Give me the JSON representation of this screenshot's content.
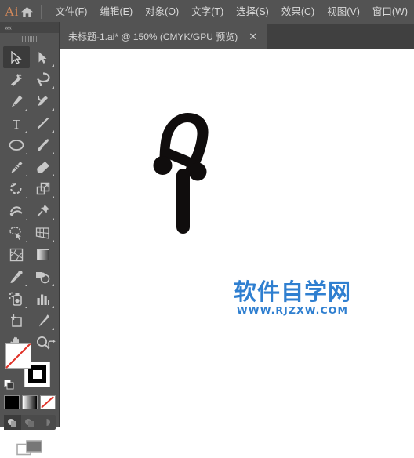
{
  "app": {
    "logo_text": "Ai",
    "logo_color": "#d2885a",
    "home_icon": "home-icon"
  },
  "menubar": {
    "items": [
      {
        "label": "文件(F)",
        "name": "menu-file"
      },
      {
        "label": "编辑(E)",
        "name": "menu-edit"
      },
      {
        "label": "对象(O)",
        "name": "menu-object"
      },
      {
        "label": "文字(T)",
        "name": "menu-type"
      },
      {
        "label": "选择(S)",
        "name": "menu-select"
      },
      {
        "label": "效果(C)",
        "name": "menu-effect"
      },
      {
        "label": "视图(V)",
        "name": "menu-view"
      },
      {
        "label": "窗口(W)",
        "name": "menu-window"
      }
    ]
  },
  "tabbar": {
    "active_tab": {
      "title": "未标题-1.ai* @ 150% (CMYK/GPU 预览)",
      "close_label": "✕",
      "document_name": "未标题-1.ai",
      "modified": true,
      "zoom": "150%",
      "color_mode": "CMYK",
      "preview_mode": "GPU 预览"
    }
  },
  "toolpanel": {
    "collapse_label": "««",
    "active_tool": "selection-tool",
    "tools": [
      {
        "name": "selection-tool",
        "icon": "arrow-cursor-icon",
        "has_flyout": false
      },
      {
        "name": "direct-selection-tool",
        "icon": "white-arrow-cursor-icon",
        "has_flyout": true
      },
      {
        "name": "magic-wand-tool",
        "icon": "magic-wand-icon",
        "has_flyout": false
      },
      {
        "name": "lasso-tool",
        "icon": "lasso-icon",
        "has_flyout": true
      },
      {
        "name": "pen-tool",
        "icon": "pen-nib-icon",
        "has_flyout": true
      },
      {
        "name": "curvature-tool",
        "icon": "curvature-pen-icon",
        "has_flyout": true
      },
      {
        "name": "type-tool",
        "icon": "type-T-icon",
        "has_flyout": true
      },
      {
        "name": "line-segment-tool",
        "icon": "diagonal-line-icon",
        "has_flyout": true
      },
      {
        "name": "ellipse-tool",
        "icon": "ellipse-icon",
        "has_flyout": true
      },
      {
        "name": "paintbrush-tool",
        "icon": "paintbrush-icon",
        "has_flyout": true
      },
      {
        "name": "shaper-tool",
        "icon": "pencil-shaper-icon",
        "has_flyout": true
      },
      {
        "name": "eraser-tool",
        "icon": "eraser-icon",
        "has_flyout": true
      },
      {
        "name": "rotate-tool",
        "icon": "rotate-icon",
        "has_flyout": true
      },
      {
        "name": "scale-tool",
        "icon": "scale-boxes-icon",
        "has_flyout": true
      },
      {
        "name": "width-tool",
        "icon": "width-warp-icon",
        "has_flyout": true
      },
      {
        "name": "free-transform-tool",
        "icon": "pushpin-icon",
        "has_flyout": true
      },
      {
        "name": "shape-builder-tool",
        "icon": "shape-builder-icon",
        "has_flyout": true
      },
      {
        "name": "perspective-grid-tool",
        "icon": "perspective-grid-icon",
        "has_flyout": true
      },
      {
        "name": "mesh-tool",
        "icon": "mesh-icon",
        "has_flyout": false
      },
      {
        "name": "gradient-tool",
        "icon": "gradient-icon",
        "has_flyout": false
      },
      {
        "name": "eyedropper-tool",
        "icon": "eyedropper-icon",
        "has_flyout": true
      },
      {
        "name": "blend-tool",
        "icon": "blend-icon",
        "has_flyout": true
      },
      {
        "name": "symbol-sprayer-tool",
        "icon": "symbol-sprayer-icon",
        "has_flyout": true
      },
      {
        "name": "column-graph-tool",
        "icon": "bar-chart-icon",
        "has_flyout": true
      },
      {
        "name": "artboard-tool",
        "icon": "artboard-icon",
        "has_flyout": false
      },
      {
        "name": "slice-tool",
        "icon": "slice-knife-icon",
        "has_flyout": true
      },
      {
        "name": "hand-tool",
        "icon": "hand-icon",
        "has_flyout": true
      },
      {
        "name": "zoom-tool",
        "icon": "magnifier-icon",
        "has_flyout": false
      }
    ],
    "swatches": {
      "fill": {
        "name": "fill-swatch",
        "value": "none",
        "color": "#ffffff"
      },
      "stroke": {
        "name": "stroke-swatch",
        "value": "black",
        "color": "#000000"
      },
      "swap_icon": "swap-arrow-icon",
      "default_icon": "default-fill-stroke-icon",
      "modes": [
        {
          "name": "color-mode-button",
          "label": "solid-color",
          "selected": false
        },
        {
          "name": "gradient-mode-button",
          "label": "gradient",
          "selected": false
        },
        {
          "name": "none-mode-button",
          "label": "none",
          "selected": true
        }
      ],
      "draw_modes": [
        {
          "name": "draw-normal-button",
          "selected": true
        },
        {
          "name": "draw-behind-button",
          "selected": false
        },
        {
          "name": "draw-inside-button",
          "selected": false
        }
      ],
      "screen_mode": {
        "name": "screen-mode-button",
        "icon": "screen-mode-icon"
      }
    }
  },
  "canvas": {
    "background": "#ffffff",
    "artwork": {
      "name": "letter-a-artwork",
      "color": "#100d0d",
      "description": "stylized letter A shape with vertical stem"
    },
    "watermark": {
      "title": "软件自学网",
      "url": "WWW.RJZXW.COM",
      "color": "#2f7fd0"
    }
  }
}
